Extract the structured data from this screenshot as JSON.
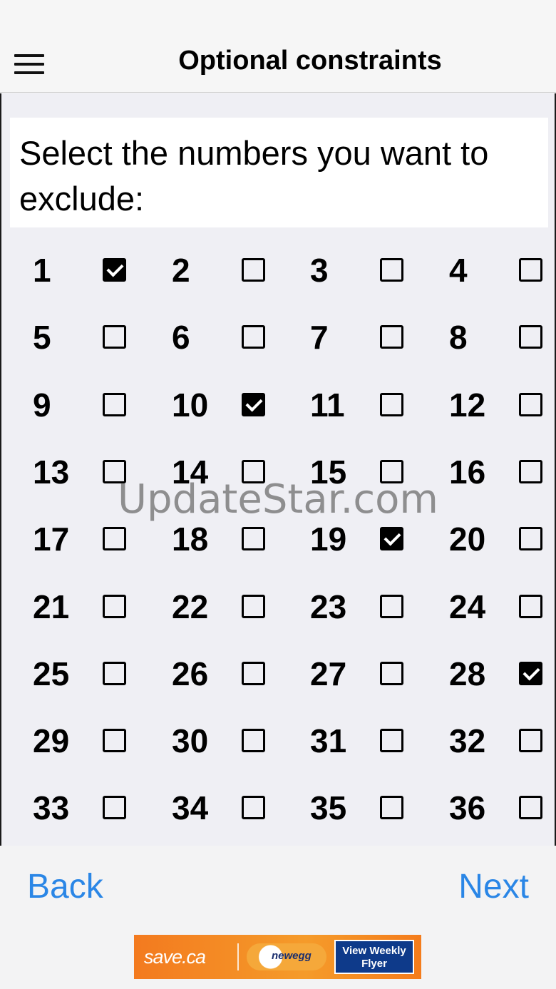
{
  "header": {
    "title": "Optional constraints",
    "menu_icon": "hamburger-menu-icon"
  },
  "prompt": "Select the numbers you want to exclude:",
  "numbers": [
    {
      "n": "1",
      "checked": true
    },
    {
      "n": "2",
      "checked": false
    },
    {
      "n": "3",
      "checked": false
    },
    {
      "n": "4",
      "checked": false
    },
    {
      "n": "5",
      "checked": false
    },
    {
      "n": "6",
      "checked": false
    },
    {
      "n": "7",
      "checked": false
    },
    {
      "n": "8",
      "checked": false
    },
    {
      "n": "9",
      "checked": false
    },
    {
      "n": "10",
      "checked": true
    },
    {
      "n": "11",
      "checked": false
    },
    {
      "n": "12",
      "checked": false
    },
    {
      "n": "13",
      "checked": false
    },
    {
      "n": "14",
      "checked": false
    },
    {
      "n": "15",
      "checked": false
    },
    {
      "n": "16",
      "checked": false
    },
    {
      "n": "17",
      "checked": false
    },
    {
      "n": "18",
      "checked": false
    },
    {
      "n": "19",
      "checked": true
    },
    {
      "n": "20",
      "checked": false
    },
    {
      "n": "21",
      "checked": false
    },
    {
      "n": "22",
      "checked": false
    },
    {
      "n": "23",
      "checked": false
    },
    {
      "n": "24",
      "checked": false
    },
    {
      "n": "25",
      "checked": false
    },
    {
      "n": "26",
      "checked": false
    },
    {
      "n": "27",
      "checked": false
    },
    {
      "n": "28",
      "checked": true
    },
    {
      "n": "29",
      "checked": false
    },
    {
      "n": "30",
      "checked": false
    },
    {
      "n": "31",
      "checked": false
    },
    {
      "n": "32",
      "checked": false
    },
    {
      "n": "33",
      "checked": false
    },
    {
      "n": "34",
      "checked": false
    },
    {
      "n": "35",
      "checked": false
    },
    {
      "n": "36",
      "checked": false
    }
  ],
  "watermark": "UpdateStar.com",
  "footer": {
    "back_label": "Back",
    "next_label": "Next"
  },
  "ad": {
    "logo": "save.ca",
    "brand": "newegg",
    "cta": "View Weekly Flyer"
  },
  "colors": {
    "link": "#2a86e6",
    "background": "#efeff4",
    "ad": "#f37a1f"
  }
}
